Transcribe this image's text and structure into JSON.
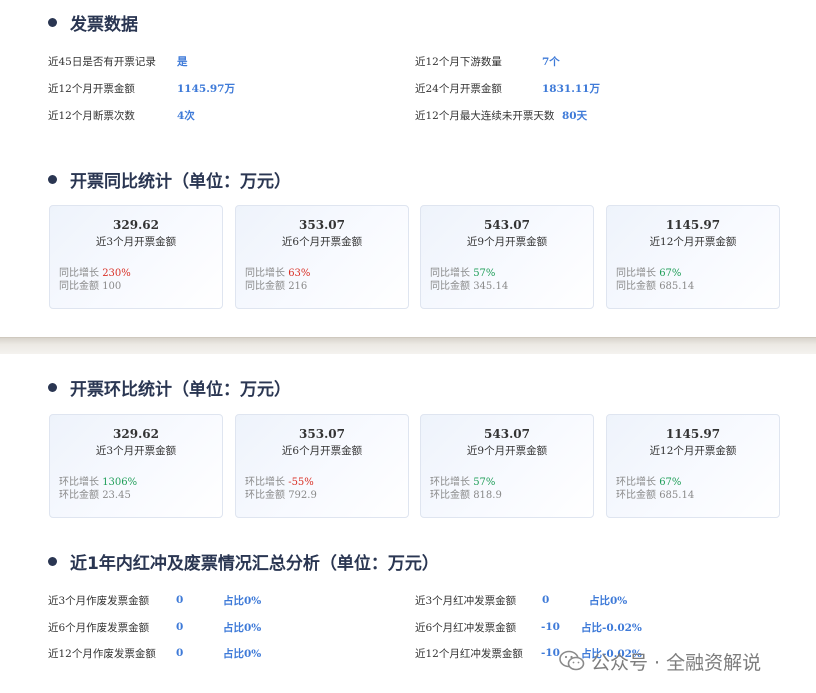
{
  "sections": {
    "invoice": "发票数据",
    "yoy": "开票同比统计（单位：万元）",
    "mom": "开票环比统计（单位：万元）",
    "red": "近1年内红冲及废票情况汇总分析（单位：万元）"
  },
  "invoice_data": [
    {
      "label": "近45日是否有开票记录",
      "value": "是"
    },
    {
      "label": "近12个月下游数量",
      "value": "7个"
    },
    {
      "label": "近12个月开票金额",
      "value": "1145.97万"
    },
    {
      "label": "近24个月开票金额",
      "value": "1831.11万"
    },
    {
      "label": "近12个月断票次数",
      "value": "4次"
    },
    {
      "label": "近12个月最大连续未开票天数",
      "value": "80天"
    }
  ],
  "yoy_cards": [
    {
      "amount": "329.62",
      "caption": "近3个月开票金额",
      "growth_label": "同比增长",
      "growth": "230%",
      "base_label": "同比金额",
      "base": "100"
    },
    {
      "amount": "353.07",
      "caption": "近6个月开票金额",
      "growth_label": "同比增长",
      "growth": "63%",
      "base_label": "同比金额",
      "base": "216"
    },
    {
      "amount": "543.07",
      "caption": "近9个月开票金额",
      "growth_label": "同比增长",
      "growth": "57%",
      "base_label": "同比金额",
      "base": "345.14"
    },
    {
      "amount": "1145.97",
      "caption": "近12个月开票金额",
      "growth_label": "同比增长",
      "growth": "67%",
      "base_label": "同比金额",
      "base": "685.14"
    }
  ],
  "mom_cards": [
    {
      "amount": "329.62",
      "caption": "近3个月开票金额",
      "growth_label": "环比增长",
      "growth": "1306%",
      "base_label": "环比金额",
      "base": "23.45"
    },
    {
      "amount": "353.07",
      "caption": "近6个月开票金额",
      "growth_label": "环比增长",
      "growth": "-55%",
      "base_label": "环比金额",
      "base": "792.9"
    },
    {
      "amount": "543.07",
      "caption": "近9个月开票金额",
      "growth_label": "环比增长",
      "growth": "57%",
      "base_label": "环比金额",
      "base": "818.9"
    },
    {
      "amount": "1145.97",
      "caption": "近12个月开票金额",
      "growth_label": "环比增长",
      "growth": "67%",
      "base_label": "环比金额",
      "base": "685.14"
    }
  ],
  "red_void": [
    {
      "label": "近3个月作废发票金额",
      "value": "0",
      "ratio": "占比0%"
    },
    {
      "label": "近3个月红冲发票金额",
      "value": "0",
      "ratio": "占比0%"
    },
    {
      "label": "近6个月作废发票金额",
      "value": "0",
      "ratio": "占比0%"
    },
    {
      "label": "近6个月红冲发票金额",
      "value": "-10",
      "ratio": "占比-0.02%"
    },
    {
      "label": "近12个月作废发票金额",
      "value": "0",
      "ratio": "占比0%"
    },
    {
      "label": "近12个月红冲发票金额",
      "value": "-10",
      "ratio": "占比-0.02%"
    }
  ],
  "watermark": {
    "text": "公众号 · 全融资解说",
    "icon": "wechat-icon"
  },
  "colors": {
    "accent": "#3e7ad8",
    "heading": "#2a3652",
    "up": "#d93025",
    "down": "#1f9e58"
  }
}
